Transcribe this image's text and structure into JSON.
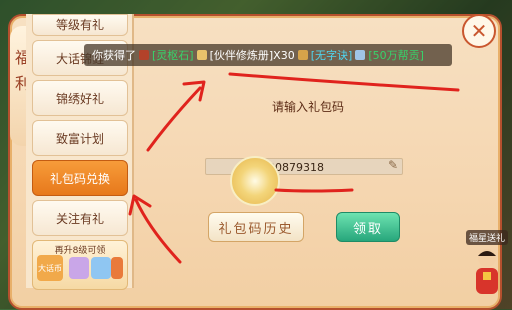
{
  "side_tab": {
    "chars": [
      "福",
      "利"
    ]
  },
  "nav": {
    "items": [
      {
        "label": "等级有礼",
        "state": "partial"
      },
      {
        "label": "大话锦鲤",
        "state": "normal"
      },
      {
        "label": "锦绣好礼",
        "state": "normal"
      },
      {
        "label": "致富计划",
        "state": "normal"
      },
      {
        "label": "礼包码兑换",
        "state": "active"
      },
      {
        "label": "关注有礼",
        "state": "normal"
      }
    ],
    "promo": {
      "text": "再升8级可领",
      "badge": "大话币"
    }
  },
  "notice": {
    "prefix": "你获得了",
    "items": [
      {
        "text": "[灵枢石]",
        "color": "#37d36b"
      },
      {
        "text": "[伙伴修炼册]X30",
        "color": "#ffffff"
      },
      {
        "text": "[无字诀]",
        "color": "#4ed6f0"
      },
      {
        "text": "[50万帮贡]",
        "color": "#37d36b"
      }
    ]
  },
  "redeem": {
    "prompt": "请输入礼包码",
    "code_value": "9790879318",
    "history_button": "礼包码历史",
    "receive_button": "领取"
  },
  "fuxing": {
    "label": "福星送礼"
  },
  "colors": {
    "annotation": "#e0231d",
    "active_tab": "#e7781b",
    "receive": "#27a67b"
  }
}
